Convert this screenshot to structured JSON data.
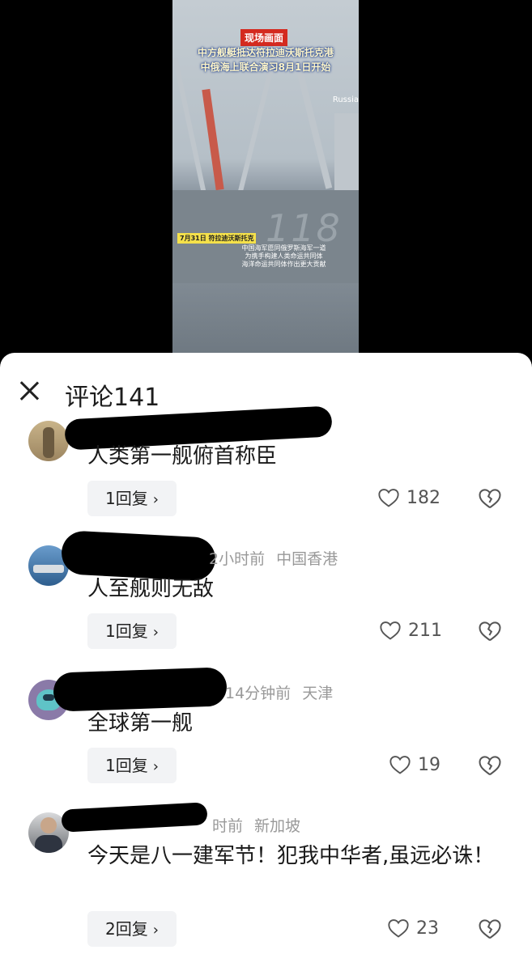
{
  "video": {
    "badge": "现场画面",
    "headline_line1": "中方舰艇抵达符拉迪沃斯托克港",
    "headline_line2": "中俄海上联合演习8月1日开始",
    "corner_text": "Russia",
    "hull_number": "118",
    "date_tag": "7月31日 符拉迪沃斯托克",
    "caption_lines": [
      "中国海军愿同俄罗斯海军一道",
      "为携手构建人类命运共同体",
      "海洋命运共同体作出更大贡献"
    ]
  },
  "comments_panel": {
    "title": "评论141",
    "close_icon": "close-icon"
  },
  "comments": [
    {
      "time": "",
      "location": "",
      "text": "人类第一舰俯首称臣",
      "replies": "1回复",
      "likes": "182"
    },
    {
      "time": "2小时前",
      "location": "中国香港",
      "text": "人至舰则无敌",
      "replies": "1回复",
      "likes": "211"
    },
    {
      "time": "14分钟前",
      "location": "天津",
      "text": "全球第一舰",
      "replies": "1回复",
      "likes": "19"
    },
    {
      "time": "时前",
      "location": "新加坡",
      "text": "今天是八一建军节！犯我中华者,虽远必诛！",
      "replies": "2回复",
      "likes": "23"
    }
  ],
  "colors": {
    "video_bg": "#000000",
    "sheet_bg": "#ffffff",
    "reply_bg": "#f2f3f5",
    "meta": "#999999",
    "badge": "#d42a1f"
  }
}
